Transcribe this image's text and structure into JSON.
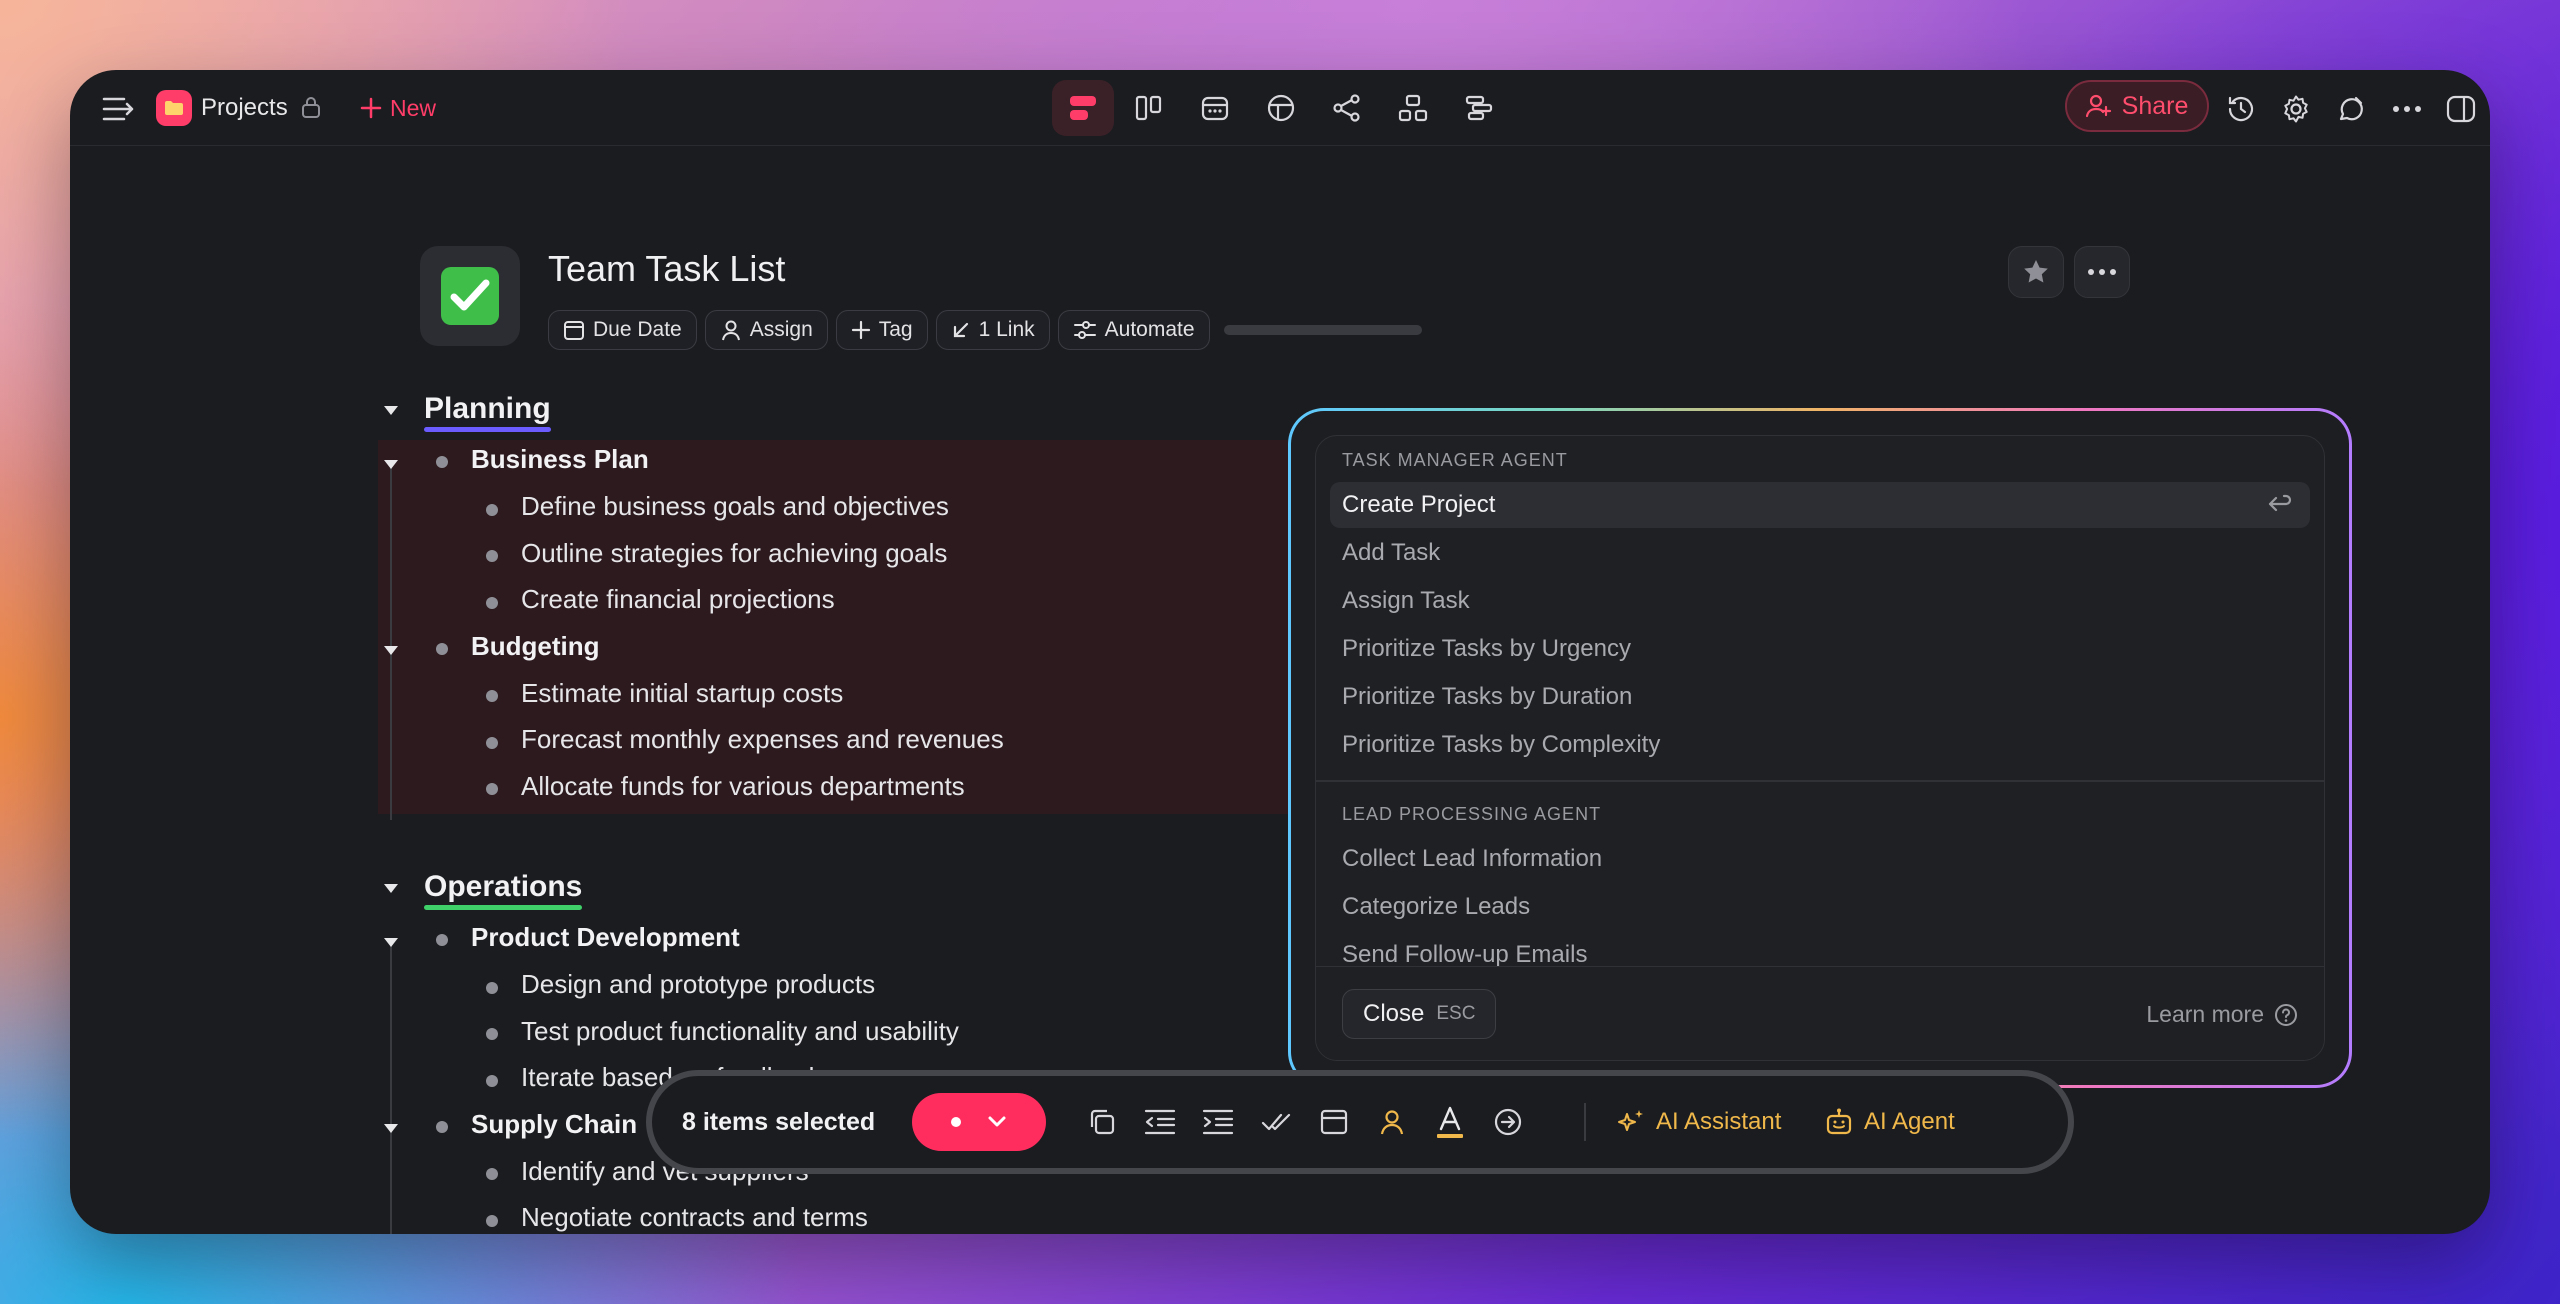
{
  "app": {
    "workspace_label": "Projects",
    "new_label": "New",
    "share_label": "Share"
  },
  "page": {
    "title": "Team Task List",
    "emoji": "✅",
    "chips": {
      "due_date": "Due Date",
      "assign": "Assign",
      "tag": "Tag",
      "link": "1 Link",
      "automate": "Automate"
    }
  },
  "outline": {
    "planning": {
      "title": "Planning",
      "business_plan": {
        "title": "Business Plan",
        "items": [
          "Define business goals and objectives",
          "Outline strategies for achieving goals",
          "Create financial projections"
        ]
      },
      "budgeting": {
        "title": "Budgeting",
        "items": [
          "Estimate initial startup costs",
          "Forecast monthly expenses and revenues",
          "Allocate funds for various departments"
        ]
      }
    },
    "operations": {
      "title": "Operations",
      "product_development": {
        "title": "Product Development",
        "items": [
          "Design and prototype products",
          "Test product functionality and usability",
          "Iterate based on feedback"
        ]
      },
      "supply_chain": {
        "title": "Supply Chain",
        "items": [
          "Identify and vet suppliers",
          "Negotiate contracts and terms"
        ]
      }
    }
  },
  "agent_menu": {
    "groups": [
      {
        "label": "TASK MANAGER AGENT",
        "items": [
          "Create Project",
          "Add Task",
          "Assign Task",
          "Prioritize Tasks by Urgency",
          "Prioritize Tasks by Duration",
          "Prioritize Tasks by Complexity"
        ]
      },
      {
        "label": "LEAD PROCESSING AGENT",
        "items": [
          "Collect Lead Information",
          "Categorize Leads",
          "Send Follow-up Emails"
        ]
      }
    ],
    "close_label": "Close",
    "close_key": "ESC",
    "learn_more": "Learn more"
  },
  "toolbar": {
    "selected_count": "8 items selected",
    "ai_assistant": "AI Assistant",
    "ai_agent": "AI Agent"
  },
  "colors": {
    "accent": "#ff2d5e",
    "planning_underline": "#6b5cff",
    "operations_underline": "#3fd06a",
    "ai": "#f0b84a"
  }
}
